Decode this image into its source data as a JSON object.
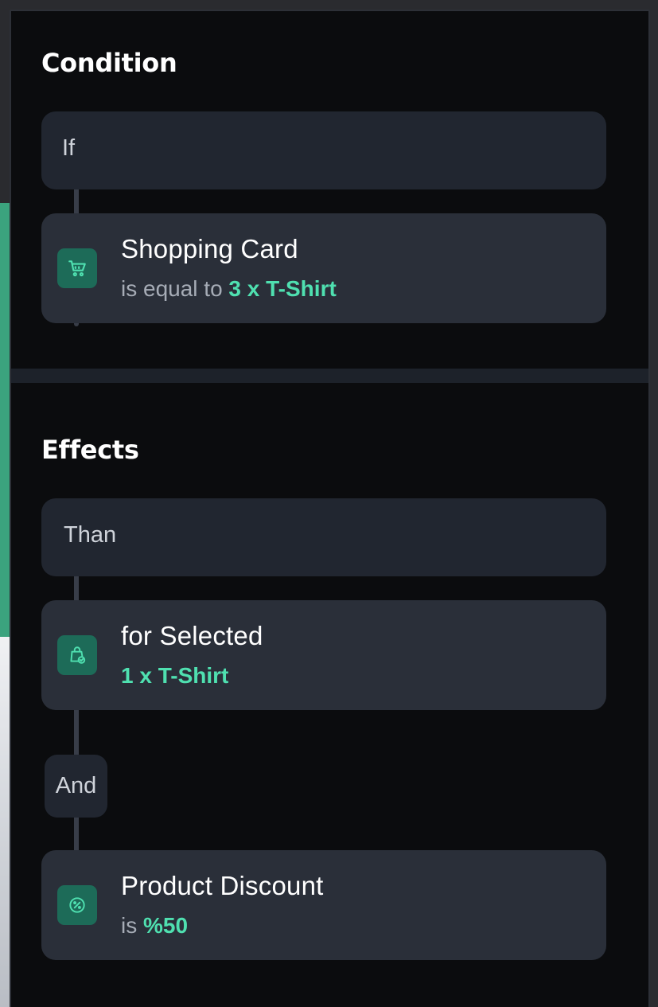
{
  "condition": {
    "title": "Condition",
    "header_label": "If",
    "item": {
      "icon": "shopping-cart-icon",
      "title": "Shopping Card",
      "sub_prefix": "is equal to",
      "sub_value": "3 x T-Shirt"
    }
  },
  "effects": {
    "title": "Effects",
    "header_label": "Than",
    "items": [
      {
        "icon": "shopping-bag-check-icon",
        "title": "for Selected",
        "sub_value": "1 x T-Shirt"
      },
      {
        "icon": "percent-badge-icon",
        "title": "Product Discount",
        "sub_prefix": "is",
        "sub_value": "%50"
      }
    ],
    "connector_label": "And"
  },
  "colors": {
    "accent": "#4fe0b0",
    "icon_bg": "#1d6b58",
    "card_bg": "#2a2f39",
    "panel_bg": "#0b0c0e"
  }
}
